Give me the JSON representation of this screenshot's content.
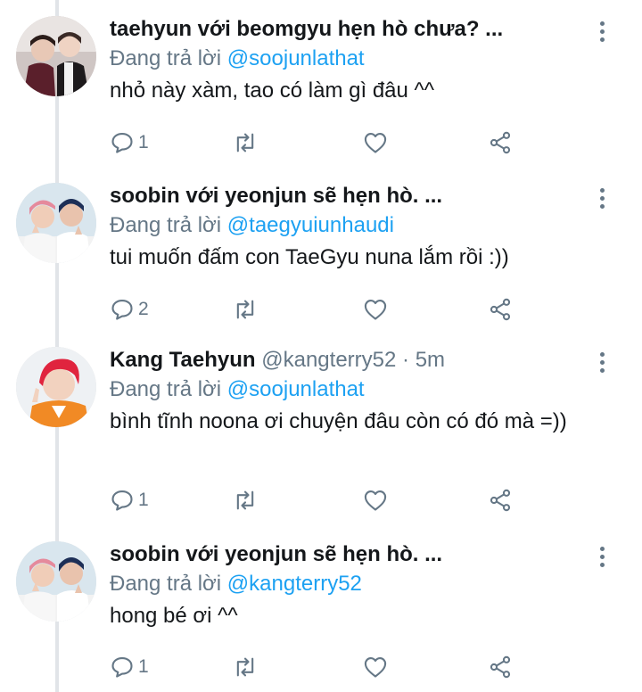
{
  "tweets": [
    {
      "name": "taehyun với beomgyu hẹn hò chưa? ...",
      "handle": "",
      "time": "",
      "reply_prefix": "Đang trả lời",
      "reply_to": "@soojunlathat",
      "text": "nhỏ này xàm, tao có làm gì đâu ^^",
      "reply_count": "1",
      "avatar_icon": "avatar-two-boys"
    },
    {
      "name": "soobin với yeonjun sẽ hẹn hò. ...",
      "handle": "",
      "time": "",
      "reply_prefix": "Đang trả lời",
      "reply_to": "@taegyuiunhaudi",
      "text": "tui muốn đấm con TaeGyu nuna lắm rồi :))",
      "reply_count": "2",
      "avatar_icon": "avatar-selfie"
    },
    {
      "name": "Kang Taehyun",
      "handle": "@kangterry52",
      "time": "5m",
      "reply_prefix": "Đang trả lời",
      "reply_to": "@soojunlathat",
      "text": "bình tĩnh noona ơi chuyện đâu còn có đó mà =))",
      "reply_count": "1",
      "avatar_icon": "avatar-red-hair"
    },
    {
      "name": "soobin với yeonjun sẽ hẹn hò. ...",
      "handle": "",
      "time": "",
      "reply_prefix": "Đang trả lời",
      "reply_to": "@kangterry52",
      "text": "hong bé ơi ^^",
      "reply_count": "1",
      "avatar_icon": "avatar-selfie"
    }
  ],
  "separator": "·",
  "colors": {
    "link": "#1da1f2",
    "secondary": "#657786",
    "primary": "#14171a",
    "thread_line": "#e1e4e8"
  },
  "icons": {
    "reply": "reply-icon",
    "retweet": "retweet-icon",
    "like": "like-icon",
    "share": "share-icon",
    "more": "more-vertical-icon"
  }
}
